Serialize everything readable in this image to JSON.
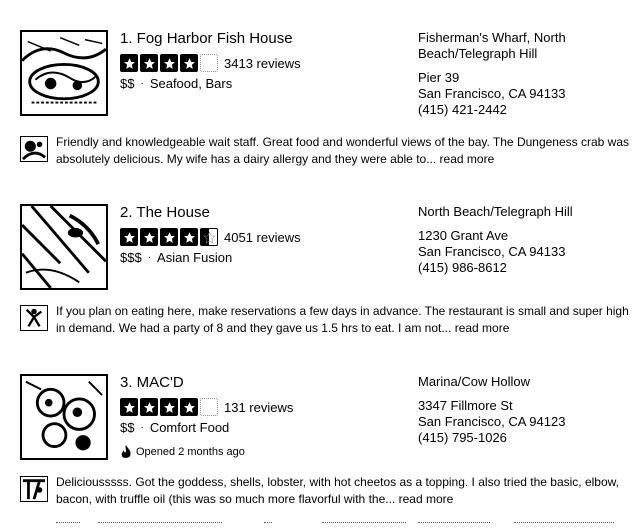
{
  "listings": [
    {
      "name": "1. Fog Harbor Fish House",
      "rating": 4,
      "reviews": "3413 reviews",
      "price": "$$",
      "categories": "Seafood, Bars",
      "neighborhood": "Fisherman's Wharf, North Beach/Telegraph Hill",
      "street": "Pier 39",
      "city": "San Francisco, CA 94133",
      "phone": "(415) 421-2442",
      "snippet": "Friendly and knowledgeable wait staff.  Great food and wonderful views of the bay.   The Dungeness crab was absolutely delicious.  My wife has a dairy allergy and  they were able to...",
      "more": "read more"
    },
    {
      "name": "2. The House",
      "rating": 4.5,
      "reviews": "4051 reviews",
      "price": "$$$",
      "categories": "Asian Fusion",
      "neighborhood": "North Beach/Telegraph Hill",
      "street": "1230 Grant Ave",
      "city": "San Francisco, CA 94133",
      "phone": "(415) 986-8612",
      "snippet": "If you plan on eating here, make reservations a few days in advance. The restaurant is small and super high in demand. We had a party of 8 and they gave us 1.5 hrs to eat. I am not...",
      "more": "read more"
    },
    {
      "name": "3. MAC'D",
      "rating": 4,
      "reviews": "131 reviews",
      "price": "$$",
      "categories": "Comfort Food",
      "opened": "Opened 2 months ago",
      "neighborhood": "Marina/Cow Hollow",
      "street": "3347 Fillmore St",
      "city": "San Francisco, CA 94123",
      "phone": "(415) 795-1026",
      "snippet": "Deliciousssss. Got the goddess, shells, lobster, with hot cheetos as a topping. I also tried the basic, elbow, bacon, with truffle oil (this was so much more flavorful with the...",
      "more": "read more"
    }
  ],
  "separator": "·"
}
